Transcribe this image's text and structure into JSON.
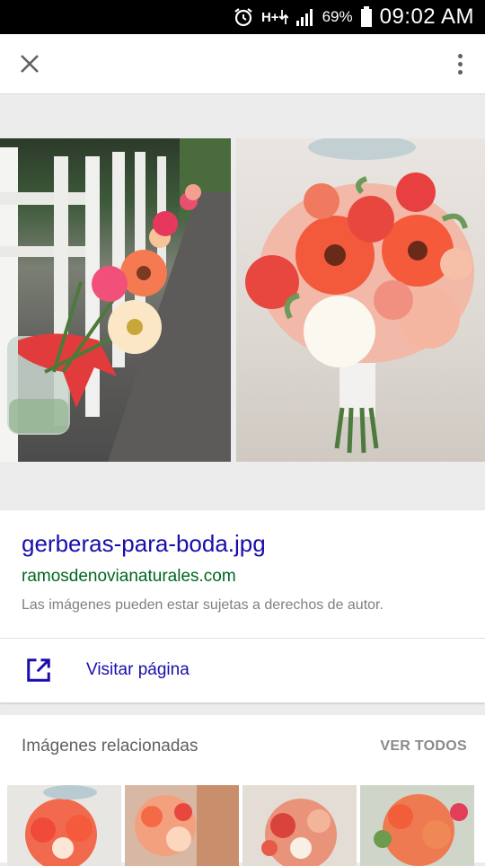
{
  "status_bar": {
    "battery": "69%",
    "time": "09:02 AM",
    "network": "H+",
    "icons": [
      "alarm-icon",
      "network-h-plus-icon",
      "signal-icon",
      "battery-icon"
    ]
  },
  "toolbar": {
    "close_icon": "close-icon",
    "more_icon": "more-vert-icon"
  },
  "image": {
    "filename": "gerberas-para-boda.jpg",
    "domain": "ramosdenovianaturales.com",
    "copyright_notice": "Las imágenes pueden estar sujetas a derechos de autor."
  },
  "visit": {
    "label": "Visitar página",
    "icon": "open-in-new-icon"
  },
  "related": {
    "title": "Imágenes relacionadas",
    "see_all": "VER TODOS",
    "thumbnails": [
      "bouquet-thumbnail-1",
      "bouquet-thumbnail-2",
      "bouquet-thumbnail-3",
      "bouquet-thumbnail-4"
    ]
  },
  "colors": {
    "link": "#1a0dab",
    "domain": "#006621",
    "muted": "#808080",
    "background": "#ececec",
    "coral": "#f0604a"
  }
}
